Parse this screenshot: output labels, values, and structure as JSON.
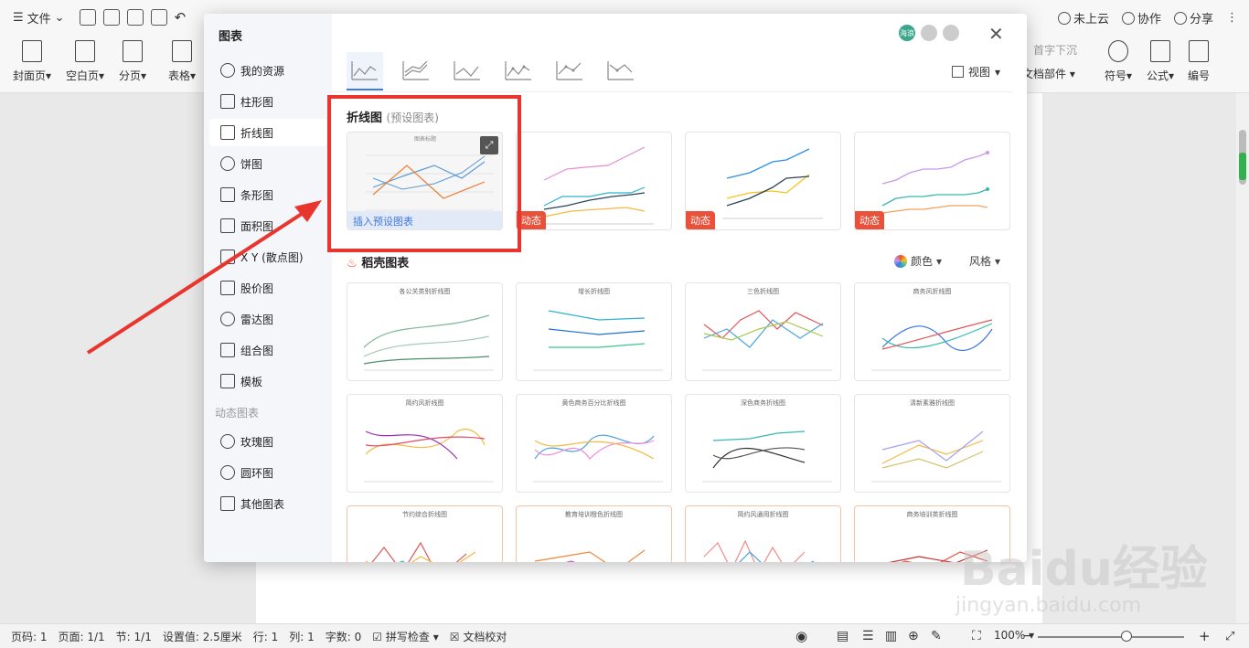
{
  "app": {
    "file_menu": "文件",
    "collab_items": [
      "未上云",
      "协作",
      "分享"
    ]
  },
  "ribbon": {
    "tools": [
      "封面页",
      "空白页",
      "分页",
      "表格"
    ],
    "right_tools": [
      "文档部件",
      "符号",
      "公式",
      "编号"
    ],
    "first_line_indent": "首字下沉"
  },
  "dialog": {
    "title": "图表",
    "nav": [
      {
        "label": "我的资源",
        "icon": "user-icon"
      },
      {
        "label": "柱形图",
        "icon": "bar-chart-icon"
      },
      {
        "label": "折线图",
        "icon": "line-chart-icon"
      },
      {
        "label": "饼图",
        "icon": "pie-chart-icon"
      },
      {
        "label": "条形图",
        "icon": "horizontal-bar-icon"
      },
      {
        "label": "面积图",
        "icon": "area-chart-icon"
      },
      {
        "label": "X Y (散点图)",
        "icon": "scatter-icon"
      },
      {
        "label": "股价图",
        "icon": "stock-icon"
      },
      {
        "label": "雷达图",
        "icon": "radar-icon"
      },
      {
        "label": "组合图",
        "icon": "combo-icon"
      },
      {
        "label": "模板",
        "icon": "template-icon"
      }
    ],
    "dynamic_section": "动态图表",
    "dynamic_nav": [
      {
        "label": "玫瑰图",
        "icon": "rose-icon"
      },
      {
        "label": "圆环图",
        "icon": "donut-icon"
      },
      {
        "label": "其他图表",
        "icon": "other-chart-icon"
      }
    ],
    "view_label": "视图",
    "avatar_text": "海浪",
    "preset": {
      "title": "折线图",
      "subtitle": "(预设图表)",
      "insert_label": "插入预设图表",
      "dynamic_badge": "动态"
    },
    "beautiful": {
      "title": "稻壳图表",
      "color_label": "颜色",
      "style_label": "风格"
    },
    "template_titles": [
      "各公关类别折线图",
      "增长折线图",
      "三色折线图",
      "商务风折线图",
      "简约风折线图",
      "黄色商务百分比折线图",
      "深色商务折线图",
      "清新素雅折线图",
      "节约综合折线图",
      "教育培训橙色折线图",
      "简约风通用折线图",
      "商务培训类折线图"
    ]
  },
  "statusbar": {
    "page": "页码: 1",
    "pages": "页面: 1/1",
    "section": "节: 1/1",
    "setting": "设置值: 2.5厘米",
    "row": "行: 1",
    "col": "列: 1",
    "words": "字数: 0",
    "spell": "拼写检查",
    "proof": "文档校对",
    "zoom": "100%"
  },
  "watermark": {
    "brand": "Baidu经验",
    "url": "jingyan.baidu.com"
  },
  "colors": {
    "accent": "#3c78e6",
    "highlight": "#e8352e",
    "dynamic": "#e9513b"
  }
}
